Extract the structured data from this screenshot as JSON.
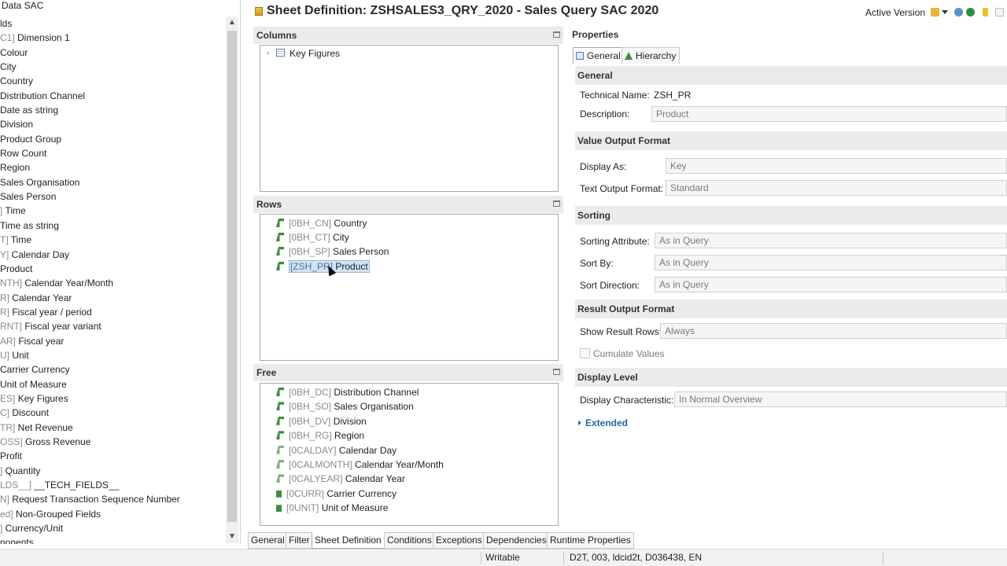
{
  "left_tree": {
    "title": "Data SAC",
    "items": [
      {
        "prefix": "",
        "name": "lds"
      },
      {
        "prefix": "C1] ",
        "name": "Dimension 1"
      },
      {
        "prefix": "",
        "name": "Colour"
      },
      {
        "prefix": "",
        "name": "City"
      },
      {
        "prefix": "",
        "name": "Country"
      },
      {
        "prefix": "",
        "name": "Distribution Channel"
      },
      {
        "prefix": "",
        "name": "Date as string"
      },
      {
        "prefix": "",
        "name": "Division"
      },
      {
        "prefix": "",
        "name": "Product Group"
      },
      {
        "prefix": "",
        "name": "Row Count"
      },
      {
        "prefix": "",
        "name": "Region"
      },
      {
        "prefix": "",
        "name": "Sales Organisation"
      },
      {
        "prefix": "",
        "name": "Sales Person"
      },
      {
        "prefix": "] ",
        "name": "Time"
      },
      {
        "prefix": "",
        "name": "Time as string"
      },
      {
        "prefix": "T] ",
        "name": "Time"
      },
      {
        "prefix": "Y] ",
        "name": "Calendar Day"
      },
      {
        "prefix": "",
        "name": "Product"
      },
      {
        "prefix": "NTH] ",
        "name": "Calendar Year/Month"
      },
      {
        "prefix": "R] ",
        "name": "Calendar Year"
      },
      {
        "prefix": "R] ",
        "name": "Fiscal year / period"
      },
      {
        "prefix": "RNT] ",
        "name": "Fiscal year variant"
      },
      {
        "prefix": "AR] ",
        "name": "Fiscal year"
      },
      {
        "prefix": "U] ",
        "name": "Unit"
      },
      {
        "prefix": "",
        "name": "Carrier Currency"
      },
      {
        "prefix": "",
        "name": "Unit of Measure"
      },
      {
        "prefix": "ES] ",
        "name": "Key Figures"
      },
      {
        "prefix": "C] ",
        "name": "Discount"
      },
      {
        "prefix": "TR] ",
        "name": "Net Revenue"
      },
      {
        "prefix": "OSS] ",
        "name": "Gross Revenue"
      },
      {
        "prefix": "",
        "name": "Profit"
      },
      {
        "prefix": "] ",
        "name": "Quantity"
      },
      {
        "prefix": "LDS__] ",
        "name": "__TECH_FIELDS__"
      },
      {
        "prefix": "N] ",
        "name": "Request Transaction Sequence Number"
      },
      {
        "prefix": "ed] ",
        "name": "Non-Grouped Fields"
      },
      {
        "prefix": "] ",
        "name": "Currency/Unit"
      },
      {
        "prefix": "",
        "name": "nonents"
      }
    ]
  },
  "header": {
    "title": "Sheet Definition: ZSHSALES3_QRY_2020 - Sales Query SAC 2020",
    "active_version": "Active Version"
  },
  "columns": {
    "title": "Columns",
    "items": [
      {
        "label": "Key Figures"
      }
    ]
  },
  "rows": {
    "title": "Rows",
    "items": [
      {
        "tech": "[0BH_CN]",
        "name": "Country"
      },
      {
        "tech": "[0BH_CT]",
        "name": "City"
      },
      {
        "tech": "[0BH_SP]",
        "name": "Sales Person"
      },
      {
        "tech": "[ZSH_PR]",
        "name": "Product"
      }
    ]
  },
  "free": {
    "title": "Free",
    "items": [
      {
        "tech": "[0BH_DC]",
        "name": "Distribution Channel"
      },
      {
        "tech": "[0BH_SO]",
        "name": "Sales Organisation"
      },
      {
        "tech": "[0BH_DV]",
        "name": "Division"
      },
      {
        "tech": "[0BH_RG]",
        "name": "Region"
      },
      {
        "tech": "[0CALDAY]",
        "name": "Calendar Day"
      },
      {
        "tech": "[0CALMONTH]",
        "name": "Calendar Year/Month"
      },
      {
        "tech": "[0CALYEAR]",
        "name": "Calendar Year"
      },
      {
        "tech": "[0CURR]",
        "name": "Carrier Currency"
      },
      {
        "tech": "[0UNIT]",
        "name": "Unit of Measure"
      }
    ]
  },
  "properties": {
    "title": "Properties",
    "tabs": [
      "General",
      "Hierarchy"
    ],
    "general": {
      "heading": "General",
      "technical_name_label": "Technical Name:",
      "technical_name_value": "ZSH_PR",
      "description_label": "Description:",
      "description_value": "Product"
    },
    "value_output": {
      "heading": "Value Output Format",
      "display_as_label": "Display As:",
      "display_as_value": "Key",
      "text_output_label": "Text Output Format:",
      "text_output_value": "Standard"
    },
    "sorting": {
      "heading": "Sorting",
      "attribute_label": "Sorting Attribute:",
      "attribute_value": "As in Query",
      "sort_by_label": "Sort By:",
      "sort_by_value": "As in Query",
      "direction_label": "Sort Direction:",
      "direction_value": "As in Query"
    },
    "result_output": {
      "heading": "Result Output Format",
      "show_result_label": "Show Result Rows:",
      "show_result_value": "Always",
      "cumulate_label": "Cumulate Values"
    },
    "display_level": {
      "heading": "Display Level",
      "characteristic_label": "Display Characteristic:",
      "characteristic_value": "In Normal Overview"
    },
    "extended_label": "Extended"
  },
  "bottom_tabs": [
    "General",
    "Filter",
    "Sheet Definition",
    "Conditions",
    "Exceptions",
    "Dependencies",
    "Runtime Properties"
  ],
  "status": {
    "mode": "Writable",
    "system": "D2T, 003, ldcid2t, D036438, EN"
  }
}
